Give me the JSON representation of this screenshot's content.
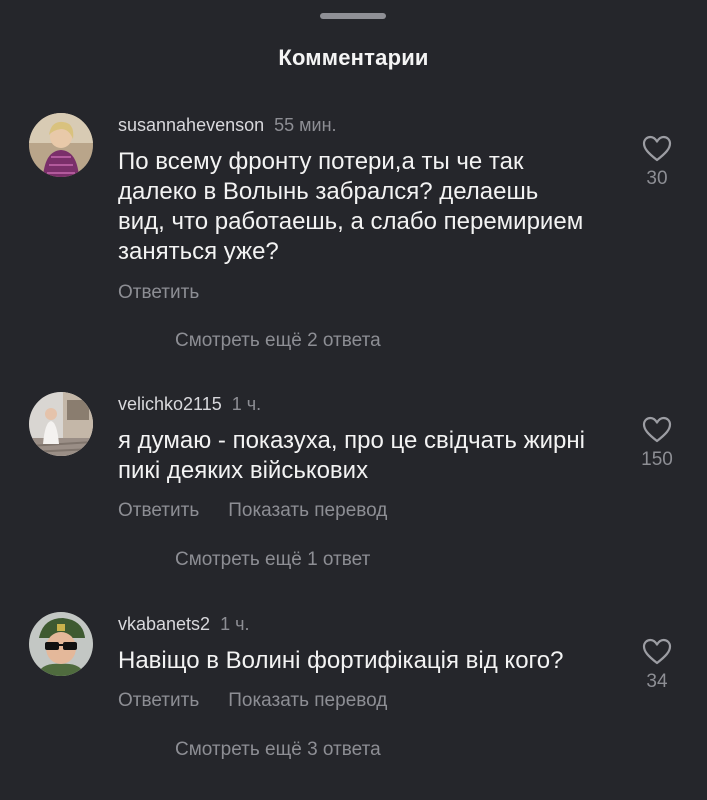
{
  "sheet": {
    "title": "Комментарии"
  },
  "comments": [
    {
      "username": "susannahevenson",
      "time": "55 мин.",
      "text": "По всему фронту потери,а ты че так далеко в Волынь забрался? делаешь вид, что работаешь, а слабо перемирием заняться уже?",
      "likes": "30",
      "reply": "Ответить",
      "translate": "",
      "more_replies": "Смотреть ещё 2 ответа",
      "avatar_icon": "user-avatar-icon"
    },
    {
      "username": "velichko2115",
      "time": "1 ч.",
      "text": "я думаю - показуха, про це свідчать жирні пикі деяких військових",
      "likes": "150",
      "reply": "Ответить",
      "translate": "Показать перевод",
      "more_replies": "Смотреть ещё 1 ответ",
      "avatar_icon": "user-avatar-icon"
    },
    {
      "username": "vkabanets2",
      "time": "1 ч.",
      "text": "Навіщо в Волині фортифікація від кого?",
      "likes": "34",
      "reply": "Ответить",
      "translate": "Показать перевод",
      "more_replies": "Смотреть ещё 3 ответа",
      "avatar_icon": "user-avatar-icon"
    }
  ],
  "colors": {
    "background": "#25262b",
    "primary_text": "#f3f3f3",
    "secondary_text": "#8d8e94"
  }
}
